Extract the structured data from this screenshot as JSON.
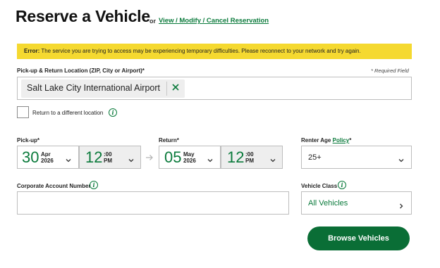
{
  "header": {
    "title": "Reserve a Vehicle",
    "or": "or",
    "reservation_link": "View / Modify / Cancel Reservation"
  },
  "error": {
    "prefix": "Error:",
    "message": "The service you are trying to access may be experiencing temporary difficulties. Please reconnect to your network and try again."
  },
  "location": {
    "label": "Pick-up & Return Location (ZIP, City or Airport)*",
    "required_note": "* Required Field",
    "value": "Salt Lake City International Airport"
  },
  "return_diff": {
    "label": "Return to a different location"
  },
  "pickup": {
    "label": "Pick-up*",
    "day": "30",
    "month": "Apr",
    "year": "2026",
    "hour": "12",
    "minutes": ":00",
    "ampm": "PM"
  },
  "return": {
    "label": "Return*",
    "day": "05",
    "month": "May",
    "year": "2026",
    "hour": "12",
    "minutes": ":00",
    "ampm": "PM"
  },
  "renter_age": {
    "label": "Renter Age",
    "policy_link": "Policy",
    "asterisk": "*",
    "value": "25+"
  },
  "corporate": {
    "label": "Corporate Account Number",
    "value": ""
  },
  "vehicle_class": {
    "label": "Vehicle Class",
    "value": "All Vehicles"
  },
  "browse_button": "Browse Vehicles",
  "colors": {
    "brand_green": "#0a7a3b",
    "button_green": "#0a6e36",
    "error_yellow": "#f5d930"
  }
}
